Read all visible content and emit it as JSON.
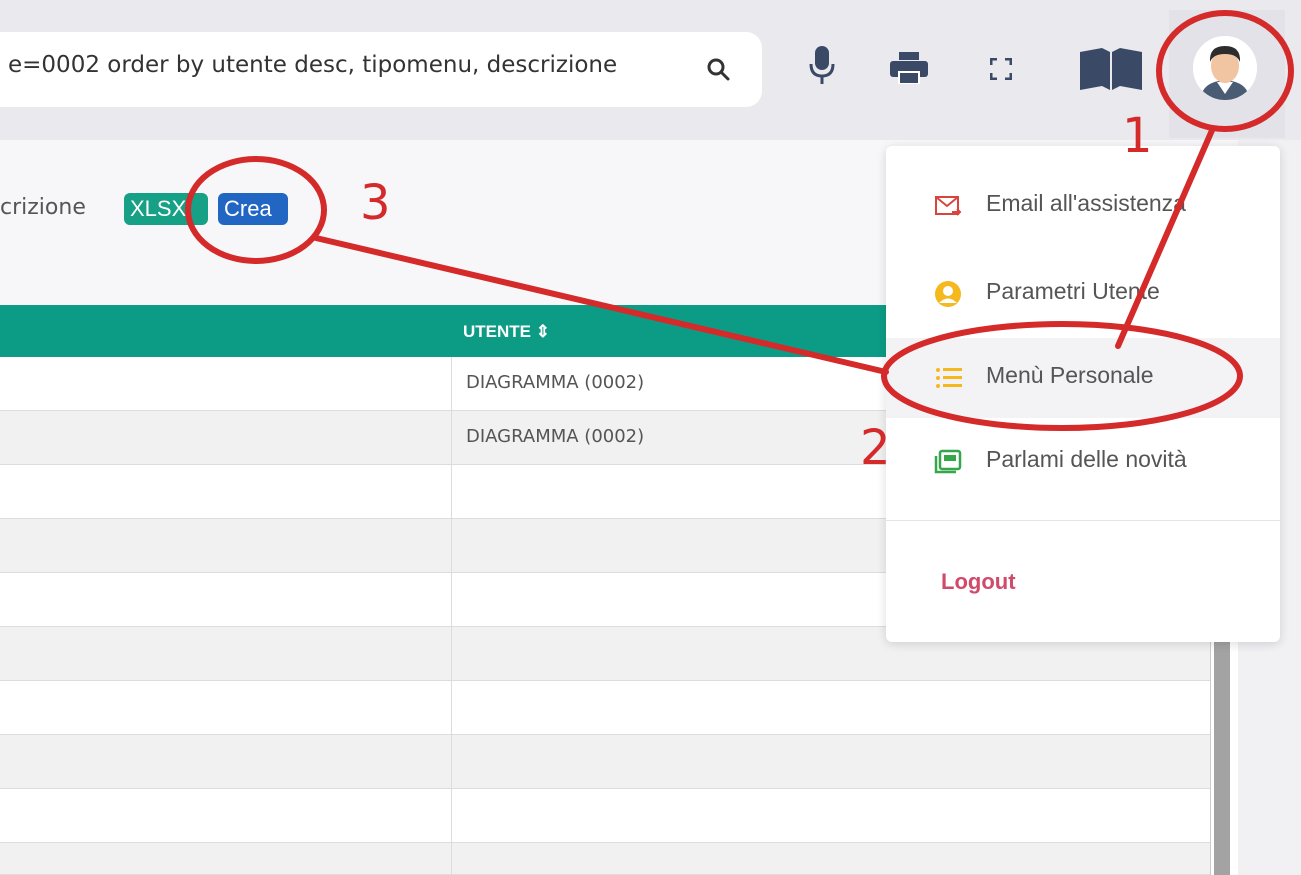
{
  "search": {
    "query": "e=0002 order by utente desc, tipomenu, descrizione"
  },
  "toolbar": {
    "label": "crizione",
    "xlsx_label": "XLSX",
    "crea_label": "Crea"
  },
  "table": {
    "header": "UTENTE ⇕",
    "rows": [
      "DIAGRAMMA (0002)",
      "DIAGRAMMA (0002)",
      "",
      "",
      "",
      "",
      "",
      "",
      "",
      ""
    ]
  },
  "menu": {
    "items": [
      {
        "label": "Email all'assistenza",
        "icon": "email-icon"
      },
      {
        "label": "Parametri Utente",
        "icon": "user-circle-icon"
      },
      {
        "label": "Menù Personale",
        "icon": "list-icon"
      },
      {
        "label": "Parlami delle novità",
        "icon": "news-icon"
      }
    ],
    "logout": "Logout"
  },
  "annotations": {
    "one": "1",
    "two": "2",
    "three": "3"
  },
  "colors": {
    "accent": "#0c9c86",
    "annotation": "#d42a2a",
    "logout": "#d14a6a",
    "xlsx": "#16a085",
    "crea": "#2266c4"
  }
}
